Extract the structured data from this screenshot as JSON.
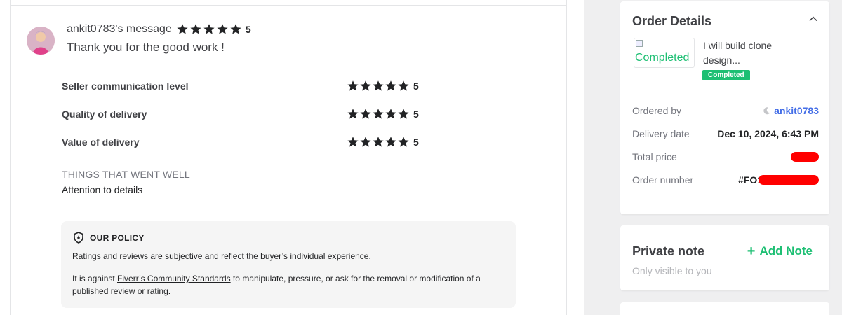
{
  "review": {
    "author_title": "ankit0783's message",
    "overall_rating": "5",
    "message": "Thank you for the good work !",
    "ratings": [
      {
        "label": "Seller communication level",
        "stars": 5,
        "score": "5"
      },
      {
        "label": "Quality of delivery",
        "stars": 5,
        "score": "5"
      },
      {
        "label": "Value of delivery",
        "stars": 5,
        "score": "5"
      }
    ],
    "went_well_title": "THINGS THAT WENT WELL",
    "went_well_items": [
      "Attention to details"
    ]
  },
  "policy": {
    "title": "OUR POLICY",
    "p1": "Ratings and reviews are subjective and reflect the buyer’s individual experience.",
    "p2_before": "It is against ",
    "p2_link": "Fiverr’s Community Standards",
    "p2_after": " to manipulate, pressure, or ask for the removal or modification of a published review or rating."
  },
  "order_details": {
    "title": "Order Details",
    "thumbnail_alt": "Completed",
    "gig_title": "I will build clone design...",
    "status_badge": "Completed",
    "rows": {
      "ordered_by_label": "Ordered by",
      "ordered_by_value": "ankit0783",
      "delivery_date_label": "Delivery date",
      "delivery_date_value": "Dec 10, 2024, 6:43 PM",
      "total_price_label": "Total price",
      "order_number_label": "Order number",
      "order_number_prefix": "#FO1"
    }
  },
  "private_note": {
    "title": "Private note",
    "subtitle": "Only visible to you",
    "add_label": "Add Note"
  },
  "icons": {
    "star": "star-icon",
    "shield": "shield-star-icon",
    "chevron": "chevron-up-icon",
    "moon": "moon-icon",
    "plus": "plus-icon"
  },
  "colors": {
    "accent_green": "#1dbf73",
    "user_link_blue": "#446ee7",
    "redaction_red": "#ff0000",
    "star_color": "#222325"
  }
}
